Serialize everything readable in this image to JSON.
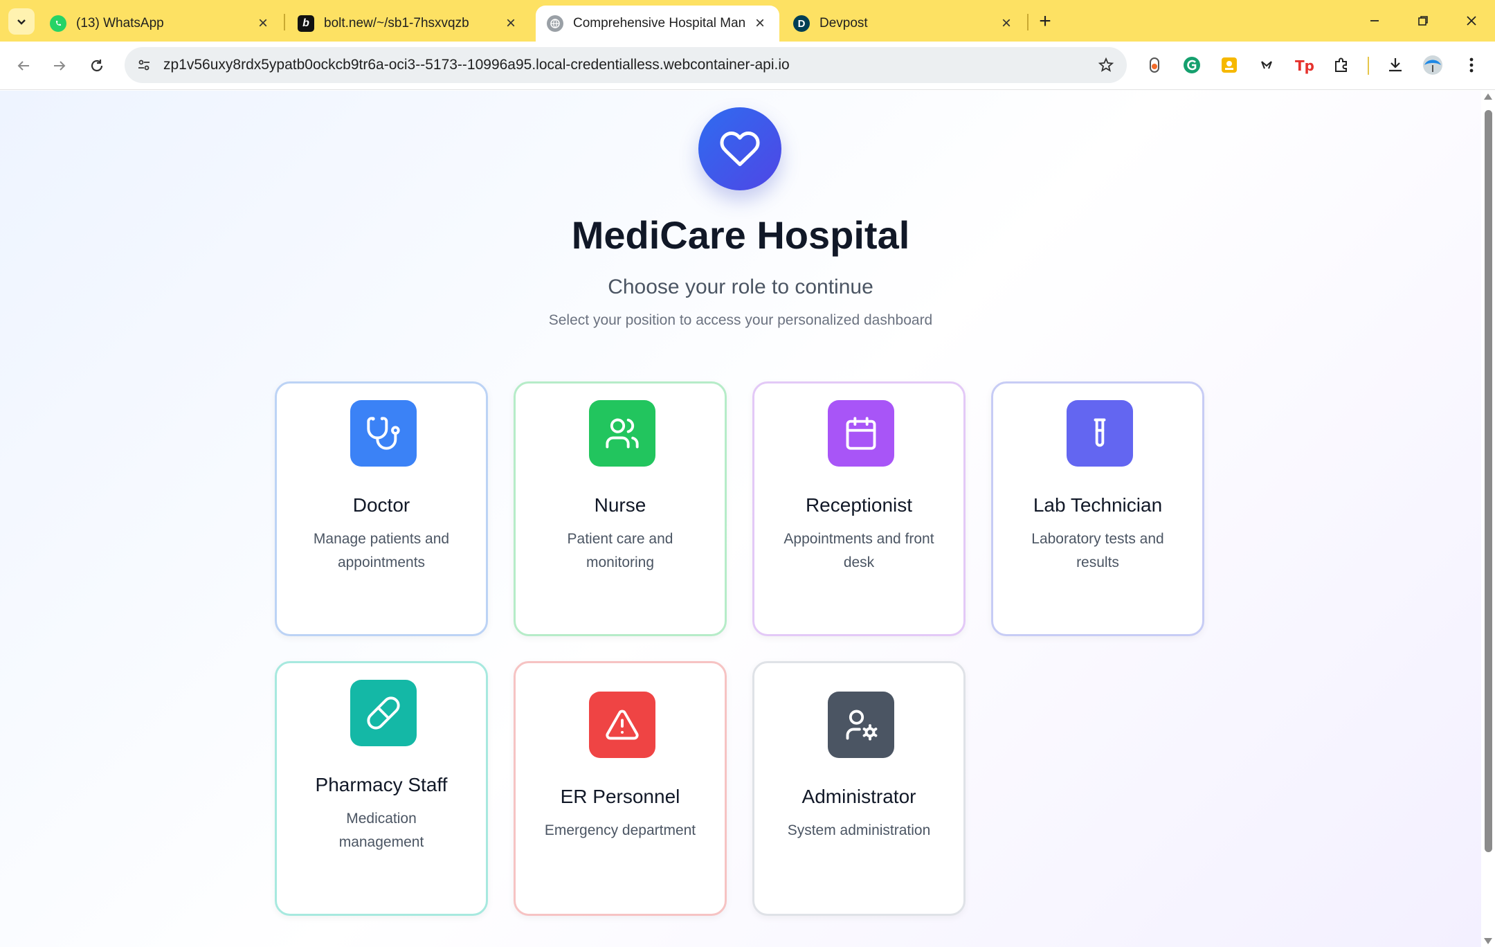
{
  "browser": {
    "tabs": [
      {
        "title": "(13) WhatsApp",
        "icon": "whatsapp-icon"
      },
      {
        "title": "bolt.new/~/sb1-7hsxvqzb",
        "icon": "bolt-icon"
      },
      {
        "title": "Comprehensive Hospital Manag",
        "icon": "globe-icon",
        "active": true
      },
      {
        "title": "Devpost",
        "icon": "devpost-icon"
      }
    ],
    "url": "zp1v56uxy8rdx5ypatb0ockcb9tr6a-oci3--5173--10996a95.local-credentialless.webcontainer-api.io"
  },
  "hero": {
    "title": "MediCare Hospital",
    "subtitle": "Choose your role to continue",
    "helper": "Select your position to access your personalized dashboard"
  },
  "roles": [
    {
      "title": "Doctor",
      "desc": "Manage patients and appointments",
      "color": "#3b82f6",
      "border": "#bcd3f5",
      "icon": "stethoscope-icon"
    },
    {
      "title": "Nurse",
      "desc": "Patient care and monitoring",
      "color": "#22c55e",
      "border": "#b6ecc8",
      "icon": "users-icon"
    },
    {
      "title": "Receptionist",
      "desc": "Appointments and front desk",
      "color": "#a855f7",
      "border": "#e3c9f7",
      "icon": "calendar-icon"
    },
    {
      "title": "Lab Technician",
      "desc": "Laboratory tests and results",
      "color": "#6366f1",
      "border": "#c7ccf5",
      "icon": "test-tube-icon"
    },
    {
      "title": "Pharmacy Staff",
      "desc": "Medication management",
      "color": "#14b8a6",
      "border": "#a7e9df",
      "icon": "pill-icon"
    },
    {
      "title": "ER Personnel",
      "desc": "Emergency department",
      "color": "#ef4444",
      "border": "#f6c3c3",
      "icon": "alert-triangle-icon"
    },
    {
      "title": "Administrator",
      "desc": "System administration",
      "color": "#4b5563",
      "border": "#dfe2e7",
      "icon": "user-cog-icon"
    }
  ]
}
